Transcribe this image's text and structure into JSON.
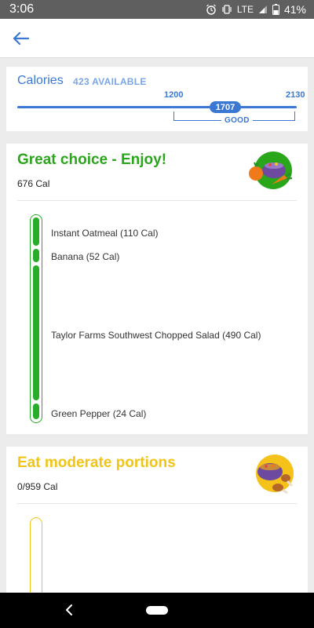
{
  "status": {
    "time": "3:06",
    "network": "LTE",
    "battery": "41%"
  },
  "calories": {
    "title": "Calories",
    "available": "423 AVAILABLE",
    "min": "1200",
    "max": "2130",
    "current": "1707",
    "status": "GOOD"
  },
  "green_section": {
    "title": "Great choice - Enjoy!",
    "subtitle": "676 Cal",
    "title_color": "#2aa61b",
    "foods": [
      {
        "label": "Instant Oatmeal (110 Cal)"
      },
      {
        "label": "Banana (52 Cal)"
      },
      {
        "label": "Taylor Farms Southwest Chopped Salad (490 Cal)"
      },
      {
        "label": "Green Pepper (24 Cal)"
      }
    ]
  },
  "yellow_section": {
    "title": "Eat moderate portions",
    "subtitle": "0/959 Cal",
    "title_color": "#f2c418"
  },
  "colors": {
    "accent": "#3a78d3",
    "green": "#27ad27",
    "yellow": "#f0c419"
  },
  "icons": {
    "back": "arrow-left-icon",
    "veg": "vegetables-bowl-icon",
    "meat": "meat-bowl-icon"
  }
}
